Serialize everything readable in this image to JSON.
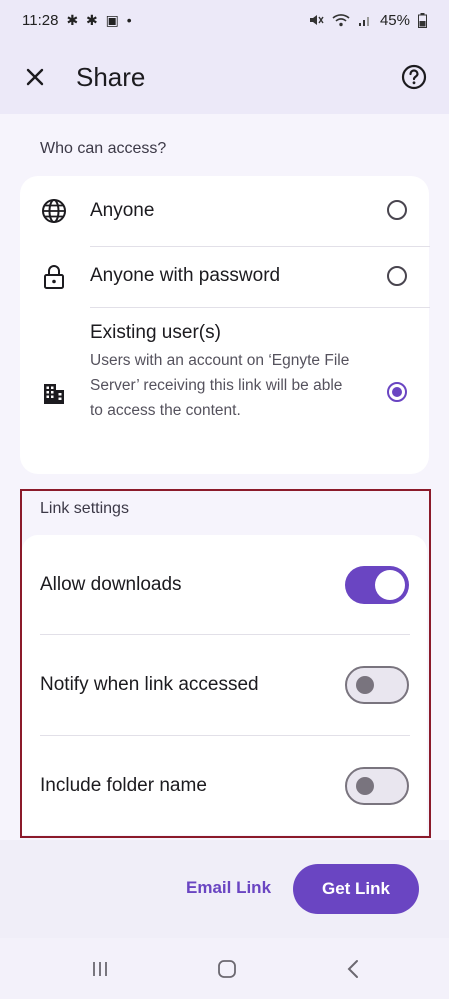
{
  "status_bar": {
    "time": "11:28",
    "left_icons": "✱ ✱ ▣ •",
    "battery": "45%"
  },
  "app_bar": {
    "title": "Share",
    "close_icon": "close-icon",
    "help_icon": "help-icon"
  },
  "access": {
    "label": "Who can access?",
    "options": [
      {
        "title": "Anyone",
        "icon": "globe-icon",
        "selected": false
      },
      {
        "title": "Anyone with password",
        "icon": "lock-icon",
        "selected": false
      },
      {
        "title": "Existing user(s)",
        "description": "Users with an account on ‘Egnyte File Server’ receiving this link will be able to access the content.",
        "icon": "building-icon",
        "selected": true
      }
    ]
  },
  "link_settings": {
    "label": "Link settings",
    "items": [
      {
        "label": "Allow downloads",
        "enabled": true
      },
      {
        "label": "Notify when link accessed",
        "enabled": false
      },
      {
        "label": "Include folder name",
        "enabled": false
      }
    ]
  },
  "actions": {
    "email_link": "Email Link",
    "get_link": "Get Link"
  },
  "colors": {
    "accent": "#6a45c2",
    "highlight_border": "#8b1a2a"
  }
}
